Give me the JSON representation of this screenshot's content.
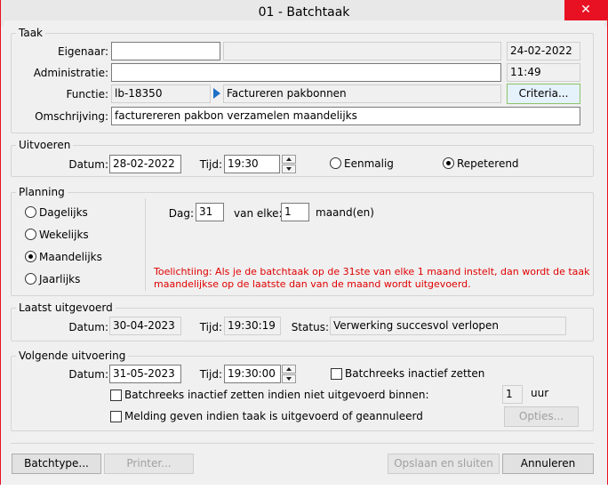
{
  "window": {
    "title": "01 - Batchtaak",
    "close_glyph": "✕"
  },
  "taak": {
    "legend": "Taak",
    "eigenaar_label": "Eigenaar:",
    "eigenaar_value": "",
    "eigenaar_value2": "",
    "date": "24-02-2022",
    "administratie_label": "Administratie:",
    "administratie_value": "",
    "time": "11:49",
    "functie_label": "Functie:",
    "functie_code": "lb-18350",
    "functie_name": "Factureren pakbonnen",
    "criteria_button": "Criteria...",
    "omschrijving_label": "Omschrijving:",
    "omschrijving_value": "facturereren pakbon verzamelen maandelijks"
  },
  "uitvoeren": {
    "legend": "Uitvoeren",
    "datum_label": "Datum:",
    "datum_value": "28-02-2022",
    "tijd_label": "Tijd:",
    "tijd_value": "19:30",
    "eenmalig_label": "Eenmalig",
    "repeterend_label": "Repeterend",
    "selected": "repeterend"
  },
  "planning": {
    "legend": "Planning",
    "options": [
      "Dagelijks",
      "Wekelijks",
      "Maandelijks",
      "Jaarlijks"
    ],
    "selected": "Maandelijks",
    "dag_label": "Dag:",
    "dag_value": "31",
    "van_elke_label": "van elke:",
    "van_elke_value": "1",
    "maand_label": "maand(en)",
    "note_line1": "Toelichtiing: Als je de batchtaak op de 31ste van elke 1 maand instelt, dan wordt de taak",
    "note_line2": "maandelijkse op de laatste dan van de maand wordt uitgevoerd."
  },
  "laatst": {
    "legend": "Laatst uitgevoerd",
    "datum_label": "Datum:",
    "datum_value": "30-04-2023",
    "tijd_label": "Tijd:",
    "tijd_value": "19:30:19",
    "status_label": "Status:",
    "status_value": "Verwerking succesvol verlopen"
  },
  "volgende": {
    "legend": "Volgende uitvoering",
    "datum_label": "Datum:",
    "datum_value": "31-05-2023",
    "tijd_label": "Tijd:",
    "tijd_value": "19:30:00",
    "inactief_label": "Batchreeks inactief zetten",
    "inactief_binnen_label": "Batchreeks inactief zetten indien niet uitgevoerd binnen:",
    "uur_value": "1",
    "uur_label": "uur",
    "melding_label": "Melding geven indien taak is uitgevoerd of geannuleerd",
    "opties_button": "Opties..."
  },
  "footer": {
    "batchtype_button": "Batchtype...",
    "printer_button": "Printer...",
    "opslaan_button": "Opslaan en sluiten",
    "annuleren_button": "Annuleren"
  }
}
